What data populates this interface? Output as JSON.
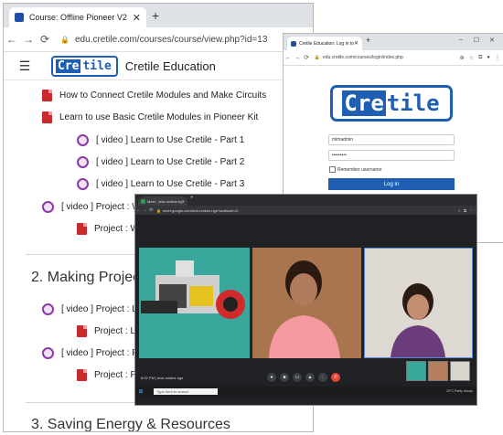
{
  "course_window": {
    "tab_title": "Course: Offline Pioneer V2",
    "url": "edu.cretile.com/courses/course/view.php?id=13",
    "logo_dark": "Cre",
    "logo_light": "tile",
    "site_name": "Cretile Education",
    "items": [
      {
        "icon": "pdf",
        "text": "How to Connect Cretile Modules and Make Circuits"
      },
      {
        "icon": "pdf",
        "text": "Learn to use Basic Cretile Modules in Pioneer Kit"
      },
      {
        "icon": "video",
        "text": "[ video ] Learn to Use Cretile - Part 1"
      },
      {
        "icon": "video",
        "text": "[ video ] Learn to Use Cretile - Part 2"
      },
      {
        "icon": "video",
        "text": "[ video ] Learn to Use Cretile - Part 3"
      },
      {
        "icon": "video",
        "text": "[ video ] Project : Wa"
      },
      {
        "icon": "pdf",
        "text": "Project : Wa"
      },
      {
        "icon": "video",
        "text": "[ video ] Project : Lig"
      },
      {
        "icon": "pdf",
        "text": "Project : Lig"
      },
      {
        "icon": "video",
        "text": "[ video ] Project : Per"
      },
      {
        "icon": "pdf",
        "text": "Project : Pe"
      }
    ],
    "sections": [
      "2. Making Project",
      "3. Saving Energy & Resources"
    ]
  },
  "login_window": {
    "tab_title": "Cretile Education: Log in to the site",
    "url": "edu.cretile.com/courses/login/index.php",
    "logo_dark": "Cre",
    "logo_light": "tile",
    "username": "mimadmin",
    "password": "•••••••••",
    "remember": "Remember username",
    "login_button": "Log in"
  },
  "meet_window": {
    "tab_title": "Meet - ievk-nmkhz-hge",
    "url": "meet.google.com/ievk-nmkhz-hge?authuser=0",
    "time": "8:02 PM | ievk-nmkhz-hge",
    "search": "Type here to search",
    "tray": "29°C Partly cloudy"
  },
  "colors": {
    "brand_blue": "#1f5fb3",
    "pdf_red": "#c9282d",
    "video_purple": "#8e3aa8",
    "end_call_red": "#ea4335"
  }
}
